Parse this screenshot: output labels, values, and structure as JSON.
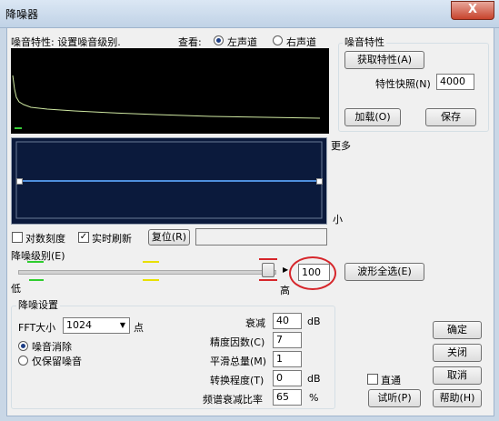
{
  "window": {
    "title": "降噪器",
    "close_label": "X"
  },
  "noise_profile_panel": {
    "label": "噪音特性: 设置噪音级别."
  },
  "view": {
    "label": "查看:",
    "left_channel": "左声道",
    "right_channel": "右声道",
    "selected": "left"
  },
  "noise_profile": {
    "group_label": "噪音特性",
    "capture_button": "获取特性(A)",
    "snapshot_label": "特性快照(N)",
    "snapshot_value": "4000",
    "load_button": "加载(O)",
    "save_button": "保存"
  },
  "curve_labels": {
    "more": "更多",
    "less": "小"
  },
  "options": {
    "log_scale": "对数刻度",
    "log_scale_checked": false,
    "live_update": "实时刷新",
    "live_update_checked": true,
    "reset_button": "复位(R)"
  },
  "noise_level": {
    "label": "降噪级别(E)",
    "low": "低",
    "high": "高",
    "value": "100",
    "level_fraction": 1.0,
    "select_all_button": "波形全选(E)"
  },
  "settings": {
    "group_label": "降噪设置",
    "fft_label": "FFT大小",
    "fft_value": "1024",
    "fft_unit": "点",
    "mode_remove": "噪音消除",
    "mode_keep": "仅保留噪音",
    "mode_selected": "remove",
    "attenuation_label": "衰减",
    "attenuation_value": "40",
    "attenuation_unit": "dB",
    "precision_label": "精度因数(C)",
    "precision_value": "7",
    "smoothing_label": "平滑总量(M)",
    "smoothing_value": "1",
    "transition_label": "转换程度(T)",
    "transition_value": "0",
    "transition_unit": "dB",
    "spectral_label": "频谱衰减比率",
    "spectral_value": "65",
    "spectral_unit": "%"
  },
  "actions": {
    "ok": "确定",
    "close": "关闭",
    "cancel": "取消",
    "bypass": "直通",
    "bypass_checked": false,
    "preview": "试听(P)",
    "help": "帮助(H)"
  },
  "colors": {
    "accent": "#1d3e86",
    "annotation": "#d6262b",
    "curve": "#4f8fdc",
    "noise_trace": "#cfe8a2"
  }
}
